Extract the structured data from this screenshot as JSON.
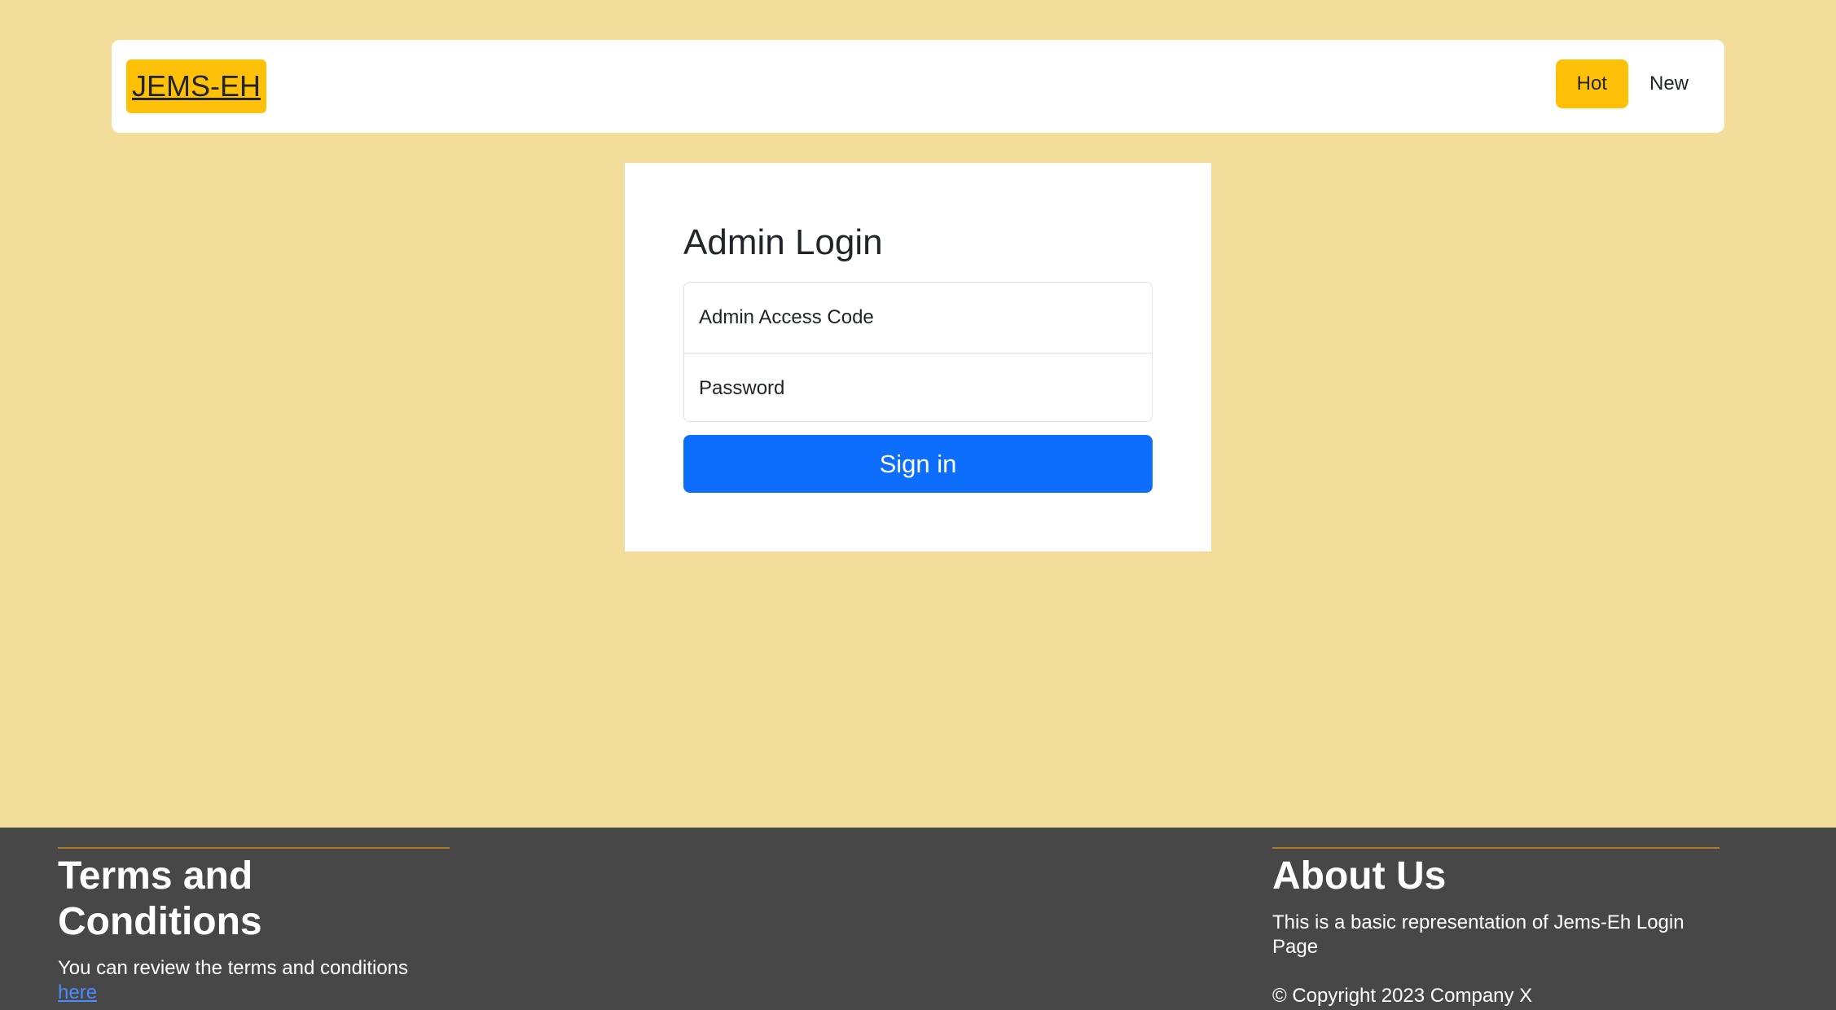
{
  "navbar": {
    "brand": "JEMS-EH",
    "links": [
      {
        "label": "Hot",
        "active": true
      },
      {
        "label": "New",
        "active": false
      }
    ]
  },
  "login": {
    "title": "Admin Login",
    "access_code_placeholder": "Admin Access Code",
    "password_placeholder": "Password",
    "submit_label": "Sign in"
  },
  "footer": {
    "terms": {
      "heading": "Terms and Conditions",
      "text": "You can review the terms and conditions",
      "link_label": "here"
    },
    "about": {
      "heading": "About Us",
      "text": "This is a basic representation of Jems-Eh Login Page",
      "copyright": "© Copyright 2023 Company X"
    }
  },
  "colors": {
    "page_background": "#f3dd9b",
    "accent": "#ffc107",
    "primary_button": "#0d6efd",
    "footer_background": "#474747"
  }
}
